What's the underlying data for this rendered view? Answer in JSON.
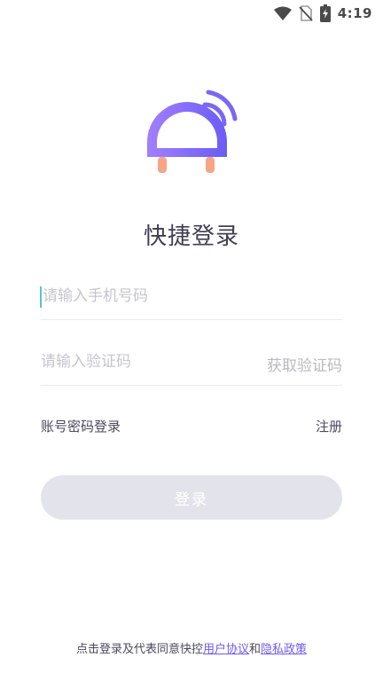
{
  "status_bar": {
    "time": "4:19",
    "icons": [
      "wifi-icon",
      "no-sim-icon",
      "battery-charging-icon"
    ]
  },
  "logo": {
    "name": "plug-wifi-logo",
    "colors": {
      "dome_start": "#9b7bff",
      "dome_end": "#6d5cf6",
      "prongs": "#f7a486"
    }
  },
  "login": {
    "title": "快捷登录",
    "phone_placeholder": "请输入手机号码",
    "code_placeholder": "请输入验证码",
    "get_code_label": "获取验证码",
    "password_login_label": "账号密码登录",
    "register_label": "注册",
    "submit_label": "登录"
  },
  "agreement": {
    "prefix": "点击登录及代表同意快控",
    "user_agreement": "用户协议",
    "and": "和",
    "privacy_policy": "隐私政策"
  },
  "colors": {
    "accent": "#6f5bf2",
    "button_disabled": "#e3e3ec",
    "caret": "#5bc4c6"
  }
}
